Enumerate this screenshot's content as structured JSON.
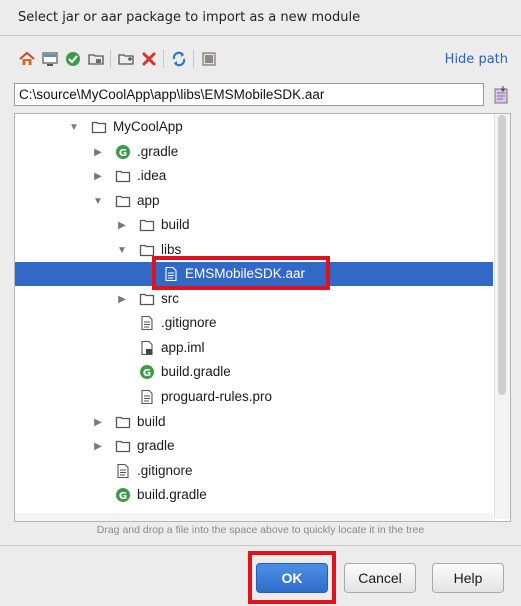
{
  "dialog": {
    "title": "Select jar or aar package to import as a new module",
    "hide_path": "Hide path",
    "path_value": "C:\\source\\MyCoolApp\\app\\libs\\EMSMobileSDK.aar",
    "hint": "Drag and drop a file into the space above to quickly locate it in the tree"
  },
  "toolbar": {
    "icons": [
      "home-icon",
      "desktop-icon",
      "project-icon",
      "module-icon",
      "new-folder-icon",
      "delete-icon",
      "refresh-icon",
      "show-hidden-icon"
    ]
  },
  "tree": {
    "rows": [
      {
        "label": "MyCoolApp",
        "type": "folder",
        "arrow": "expanded"
      },
      {
        "label": ".gradle",
        "type": "gradle",
        "arrow": "collapsed"
      },
      {
        "label": ".idea",
        "type": "folder",
        "arrow": "collapsed"
      },
      {
        "label": "app",
        "type": "folder",
        "arrow": "expanded"
      },
      {
        "label": "build",
        "type": "folder",
        "arrow": "collapsed"
      },
      {
        "label": "libs",
        "type": "folder",
        "arrow": "expanded"
      },
      {
        "label": "EMSMobileSDK.aar",
        "type": "file",
        "arrow": "none",
        "selected": true
      },
      {
        "label": "src",
        "type": "folder",
        "arrow": "collapsed"
      },
      {
        "label": ".gitignore",
        "type": "file",
        "arrow": "none"
      },
      {
        "label": "app.iml",
        "type": "iml",
        "arrow": "none"
      },
      {
        "label": "build.gradle",
        "type": "gradle",
        "arrow": "none"
      },
      {
        "label": "proguard-rules.pro",
        "type": "file",
        "arrow": "none"
      },
      {
        "label": "build",
        "type": "folder",
        "arrow": "collapsed"
      },
      {
        "label": "gradle",
        "type": "folder",
        "arrow": "collapsed"
      },
      {
        "label": ".gitignore",
        "type": "file",
        "arrow": "none"
      },
      {
        "label": "build.gradle",
        "type": "gradle",
        "arrow": "none"
      }
    ]
  },
  "buttons": {
    "ok": "OK",
    "cancel": "Cancel",
    "help": "Help"
  },
  "colors": {
    "selection": "#3268c6",
    "highlight": "#e0121b",
    "link": "#2a62b8"
  }
}
